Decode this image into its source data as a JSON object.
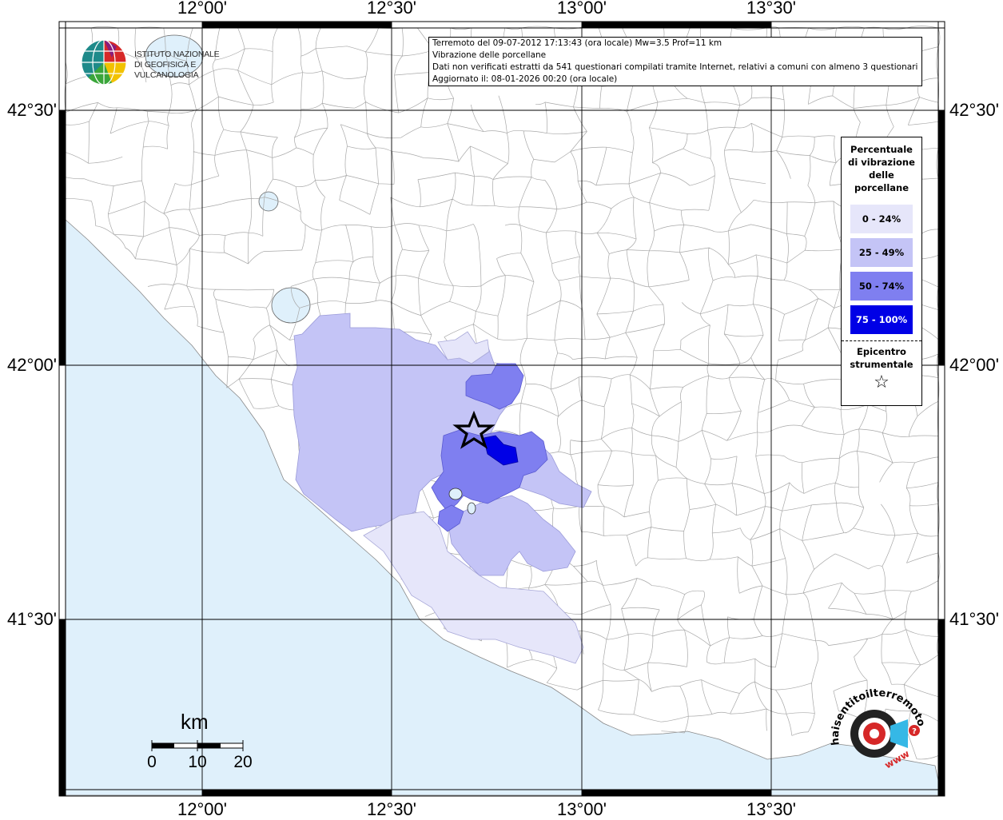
{
  "axes": {
    "top": [
      "12°00'",
      "12°30'",
      "13°00'",
      "13°30'"
    ],
    "bottom": [
      "12°00'",
      "12°30'",
      "13°00'",
      "13°30'"
    ],
    "left": [
      "42°30'",
      "42°00'",
      "41°30'"
    ],
    "right": [
      "42°30'",
      "42°00'",
      "41°30'"
    ]
  },
  "info": {
    "line1": "Terremoto del 09-07-2012 17:13:43 (ora locale) Mw=3.5 Prof=11 km",
    "line2": "Vibrazione delle porcellane",
    "line3": "Dati non verificati estratti da 541 questionari compilati tramite Internet, relativi a comuni con almeno 3 questionari.",
    "line4": "Aggiornato il: 08-01-2026 00:20 (ora locale)"
  },
  "legend": {
    "title_lines": [
      "Percentuale",
      "di vibrazione",
      "delle",
      "porcellane"
    ],
    "classes": [
      {
        "label": "0 - 24%",
        "color": "#e6e6fa",
        "text_color": "#000000"
      },
      {
        "label": "25 - 49%",
        "color": "#c4c4f6",
        "text_color": "#000000"
      },
      {
        "label": "50 - 74%",
        "color": "#7f7ff0",
        "text_color": "#000000"
      },
      {
        "label": "75 - 100%",
        "color": "#0000e6",
        "text_color": "#ffffff"
      }
    ],
    "epicenter_lines": [
      "Epicentro",
      "strumentale"
    ],
    "epicenter_symbol": "☆"
  },
  "logo_ingv": {
    "line1": "ISTITUTO NAZIONALE",
    "line2": "DI GEOFISICA E VULCANOLOGIA"
  },
  "scalebar": {
    "unit": "km",
    "ticks": [
      "0",
      "10",
      "20"
    ]
  },
  "logo_hs": {
    "text": "haisentitoilterremoto.it",
    "www": "www"
  },
  "colors": {
    "sea": "#dff0fb",
    "land": "#ffffff",
    "borders": "#9a9a9a",
    "grid": "#000000"
  }
}
